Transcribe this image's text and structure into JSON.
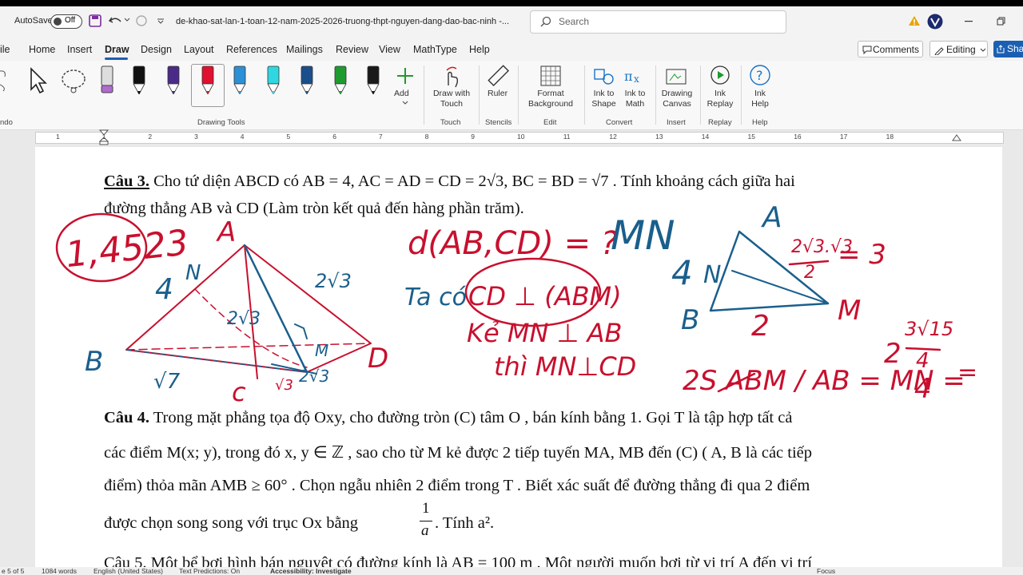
{
  "titlebar": {
    "autosave_label": "AutoSave",
    "autosave_state": "Off",
    "doc_title": "de-khao-sat-lan-1-toan-12-nam-2025-2026-truong-thpt-nguyen-dang-dao-bac-ninh  -...",
    "search_placeholder": "Search"
  },
  "menu": {
    "tabs": [
      "ile",
      "Home",
      "Insert",
      "Draw",
      "Design",
      "Layout",
      "References",
      "Mailings",
      "Review",
      "View",
      "MathType",
      "Help"
    ],
    "active": "Draw",
    "comments_label": "Comments",
    "editing_label": "Editing",
    "share_label": "Sha"
  },
  "ribbon": {
    "undo_label": "ndo",
    "add_label": "Add",
    "drawing_tools_label": "Drawing Tools",
    "draw_with_touch": "Draw with Touch",
    "touch_label": "Touch",
    "ruler_label": "Ruler",
    "stencils_label": "Stencils",
    "format_background": "Format Background",
    "edit_label": "Edit",
    "ink_to_shape": "Ink to Shape",
    "ink_to_math": "Ink to Math",
    "convert_label": "Convert",
    "drawing_canvas": "Drawing Canvas",
    "insert_label": "Insert",
    "ink_replay": "Ink Replay",
    "replay_label": "Replay",
    "ink_help": "Ink Help",
    "help_label": "Help",
    "pen_colors": [
      "#b06ad0",
      "#111111",
      "#4a2b87",
      "#e0112f",
      "#2d8fd6",
      "#2fd8e0",
      "#1b4f8c",
      "#1e9a2e",
      "#1a1a1a"
    ]
  },
  "ruler": {
    "numbers": [
      "1",
      "1",
      "2",
      "3",
      "4",
      "5",
      "6",
      "7",
      "8",
      "9",
      "10",
      "11",
      "12",
      "13",
      "14",
      "15",
      "16",
      "17",
      "18"
    ]
  },
  "document": {
    "q3_label": "Câu 3.",
    "q3_line1": "Cho tứ diện  ABCD  có  AB = 4, AC = AD = CD = 2√3, BC = BD = √7 . Tính khoảng cách giữa hai",
    "q3_line2": "đường thẳng  AB  và  CD  (Làm tròn kết quả đến hàng phần trăm).",
    "q4_label": "Câu 4.",
    "q4_line1": "Trong mặt phẳng tọa độ  Oxy,  cho đường tròn  (C)  tâm  O , bán kính bằng 1. Gọi  T   là tập hợp tất cả",
    "q4_line2": "các điểm  M(x; y), trong đó  x, y ∈ ℤ , sao cho từ  M  kẻ được 2 tiếp tuyến  MA, MB  đến  (C) ( A, B  là các tiếp",
    "q4_line3": "điểm) thỏa mãn  AMB ≥ 60° . Chọn ngẫu nhiên 2 điểm trong  T . Biết xác suất để đường thẳng đi qua 2 điểm",
    "q4_line4a": "được chọn song song với trục  Ox  bằng",
    "q4_frac_num": "1",
    "q4_frac_den": "a",
    "q4_line4b": ". Tính  a².",
    "q5_partial": "Câu 5.  Một bể bơi hình bán nguyệt có đường kính là  AB = 100 m . Một người muốn bơi từ vị trí  A đến vị trí"
  },
  "ink": {
    "answer": "1,4523",
    "A1": "A",
    "N1": "N",
    "four1": "4",
    "B1": "B",
    "C1": "c",
    "D1": "D",
    "sqrt7": "√7",
    "two_sqrt3_a": "2√3",
    "two_sqrt3_b": "2√3",
    "two_sqrt3_c": "2√3",
    "sqrt3": "√3",
    "M1": "M",
    "d_question": "d(AB,CD) = ?",
    "tacó": "Ta có",
    "cd_perp": "CD ⊥ (ABM)",
    "ke_mn": "Kẻ MN ⊥ AB",
    "thi_mn": "thì MN⊥CD",
    "MN_big": "MN",
    "A2": "A",
    "four2": "4",
    "N2": "N",
    "B2": "B",
    "M2": "M",
    "two": "2",
    "frac_top": "2√3.√3",
    "frac_bot": "2",
    "eq3": "= 3",
    "area_eq": "2S ABM / AB = MN =",
    "frac2_top": "3√15",
    "frac2_mid": "4",
    "frac2_bot": "4",
    "two2": "2",
    "eq_end": "="
  },
  "status": {
    "page": "e 5 of 5",
    "words": "1084 words",
    "lang": "English (United States)",
    "predictions": "Text Predictions: On",
    "accessibility": "Accessibility: Investigate",
    "focus": "Focus"
  }
}
